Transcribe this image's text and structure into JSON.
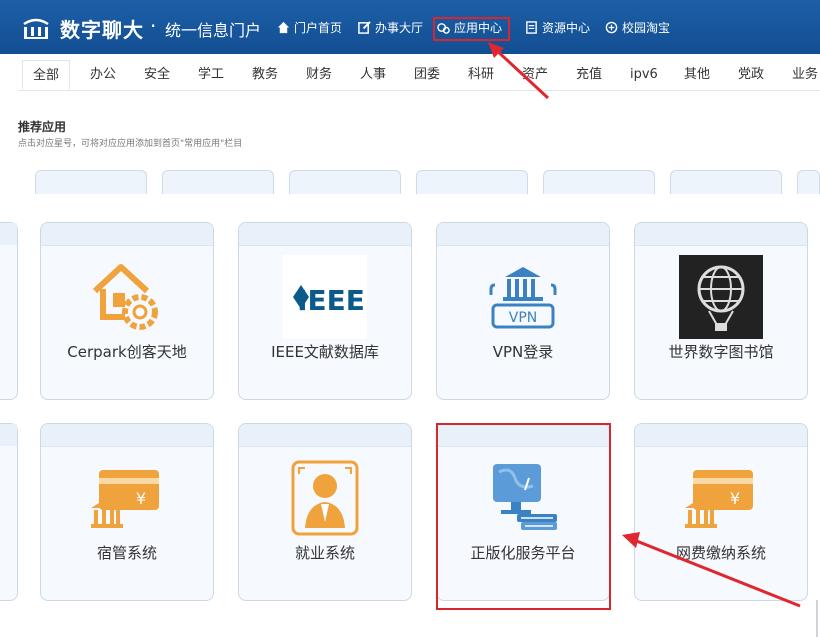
{
  "header": {
    "brand": "数字聊大",
    "separator": "·",
    "subtitle": "统一信息门户",
    "nav": [
      {
        "label": "门户首页",
        "icon": "home-icon"
      },
      {
        "label": "办事大厅",
        "icon": "edit-icon"
      },
      {
        "label": "应用中心",
        "icon": "apps-icon"
      },
      {
        "label": "资源中心",
        "icon": "document-icon"
      },
      {
        "label": "校园淘宝",
        "icon": "tag-icon"
      }
    ]
  },
  "tabs": [
    "全部",
    "办公",
    "安全",
    "学工",
    "教务",
    "财务",
    "人事",
    "团委",
    "科研",
    "资产",
    "充值",
    "ipv6",
    "其他",
    "党政",
    "业务"
  ],
  "recommend": {
    "title": "推荐应用",
    "subtitle": "点击对应星号，可将对应应用添加到首页\"常用应用\"栏目"
  },
  "apps_row1": [
    {
      "label": "Cerpark创客天地",
      "icon": "cerpark-house-gear-icon"
    },
    {
      "label": "IEEE文献数据库",
      "icon": "ieee-logo-icon"
    },
    {
      "label": "VPN登录",
      "icon": "vpn-bank-icon"
    },
    {
      "label": "世界数字图书馆",
      "icon": "globe-balloon-icon"
    }
  ],
  "apps_row2": [
    {
      "label": "宿管系统",
      "icon": "bank-card-icon"
    },
    {
      "label": "就业系统",
      "icon": "id-badge-person-icon"
    },
    {
      "label": "正版化服务平台",
      "icon": "computer-books-icon"
    },
    {
      "label": "网费缴纳系统",
      "icon": "bank-card-icon"
    }
  ],
  "colors": {
    "header_bg": "#1c5fa8",
    "highlight_red": "#d8262f",
    "icon_orange": "#f0a23c",
    "icon_blue": "#3a82c4"
  }
}
